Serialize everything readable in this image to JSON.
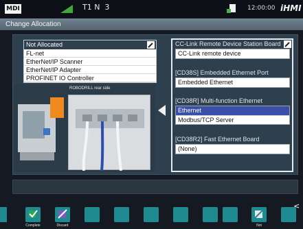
{
  "status_bar": {
    "mode": "MDI",
    "indicators": "T1 N  3",
    "clock": "12:00:00",
    "brand": "iHMI"
  },
  "title": "Change Allocation",
  "not_allocated": {
    "header": "Not Allocated",
    "items": [
      "FL-net",
      "EtherNet/IP Scanner",
      "EtherNet/IP Adapter",
      "PROFINET IO Controller"
    ]
  },
  "image_caption": "ROBODRILL rear side",
  "right_panel": {
    "groups": [
      {
        "label": "CC-Link Remote Device Station Board",
        "items": [
          "CC-Link remote device"
        ]
      },
      {
        "label": "[CD38S] Embedded Ethernet Port",
        "items": [
          "Embedded Ethernet"
        ]
      },
      {
        "label": "[CD38R] Multi-function Ethernet",
        "items": [
          "Ethernet",
          "Modbus/TCP Server"
        ],
        "selected": "Ethernet"
      },
      {
        "label": "[CD38R2] Fast Ethernet Board",
        "items": [
          "(None)"
        ]
      }
    ]
  },
  "softkeys": [
    {
      "label": "Complete"
    },
    {
      "label": "Discard"
    },
    {
      "label": ""
    },
    {
      "label": ""
    },
    {
      "label": ""
    },
    {
      "label": ""
    },
    {
      "label": ""
    },
    {
      "label": ""
    },
    {
      "label": ""
    },
    {
      "label": "Not"
    },
    {
      "label": ""
    }
  ],
  "colors": {
    "softkey": "#1f8a8f",
    "selected": "#3a4fa8",
    "title_bar": "#6d7e8c"
  }
}
